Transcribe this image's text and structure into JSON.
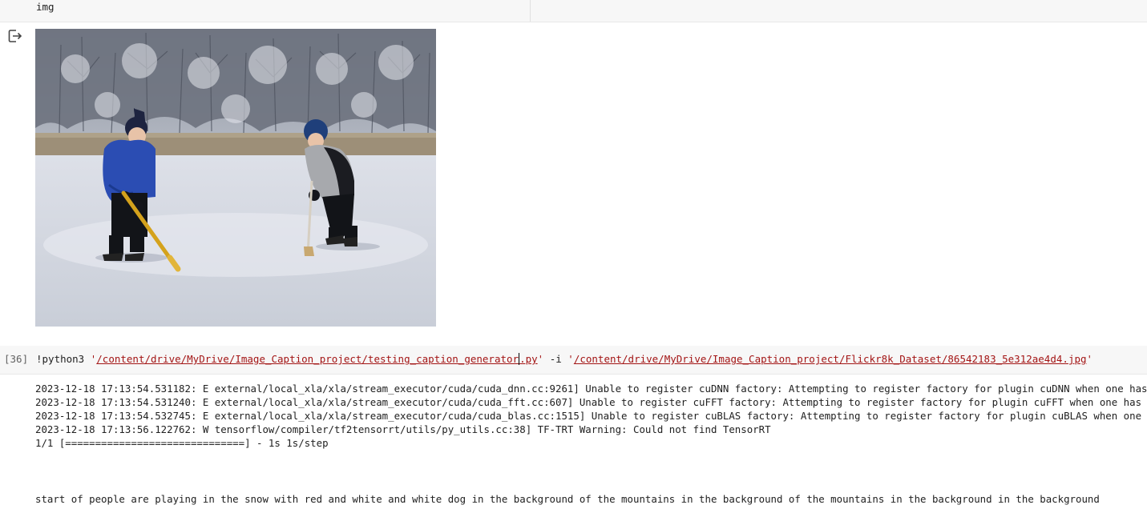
{
  "top_cell": {
    "code": "img"
  },
  "output": {
    "icon": "output-redirect-icon",
    "image_alt": "Two children playing ice hockey on a frozen lake with snowy trees"
  },
  "run_cell": {
    "exec_count": "[36]",
    "command_prefix": "!python3 ",
    "quote": "'",
    "script_path_before_cursor": "/content/drive/MyDrive/Image_Caption_project/testing_caption_generator",
    "script_path_after_cursor": ".py",
    "option": " -i ",
    "image_path": "/content/drive/MyDrive/Image_Caption_project/Flickr8k_Dataset/86542183_5e312ae4d4.jpg"
  },
  "logs": [
    "2023-12-18 17:13:54.531182: E external/local_xla/xla/stream_executor/cuda/cuda_dnn.cc:9261] Unable to register cuDNN factory: Attempting to register factory for plugin cuDNN when one has already been registered",
    "2023-12-18 17:13:54.531240: E external/local_xla/xla/stream_executor/cuda/cuda_fft.cc:607] Unable to register cuFFT factory: Attempting to register factory for plugin cuFFT when one has already been registered",
    "2023-12-18 17:13:54.532745: E external/local_xla/xla/stream_executor/cuda/cuda_blas.cc:1515] Unable to register cuBLAS factory: Attempting to register factory for plugin cuBLAS when one has already been registered",
    "2023-12-18 17:13:56.122762: W tensorflow/compiler/tf2tensorrt/utils/py_utils.cc:38] TF-TRT Warning: Could not find TensorRT",
    "1/1 [==============================] - 1s 1s/step"
  ],
  "caption": "start of people are playing in the snow with red and white and white dog in the background of the mountains in the background of the mountains in the background in the background"
}
